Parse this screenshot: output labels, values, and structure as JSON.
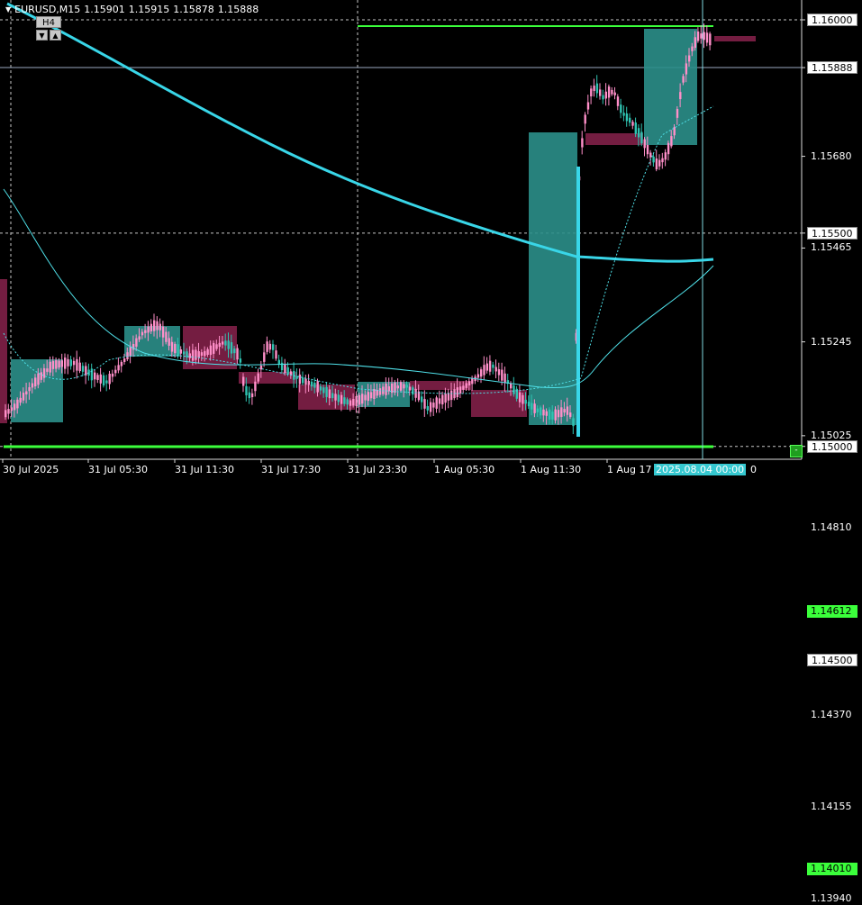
{
  "header": {
    "symbol": "EURUSD,M15",
    "open": "1.15901",
    "high": "1.15915",
    "low": "1.15878",
    "close": "1.15888",
    "timeframe_button": "H4",
    "collapse_button": "▼",
    "expand_button": "▲"
  },
  "price_axis": {
    "levels": [
      {
        "value": 1.16,
        "label": "1.16000",
        "style": "box"
      },
      {
        "value": 1.15888,
        "label": "1.15888",
        "style": "box"
      },
      {
        "value": 1.1568,
        "label": "1.15680",
        "style": "plain"
      },
      {
        "value": 1.155,
        "label": "1.15500",
        "style": "box"
      },
      {
        "value": 1.15465,
        "label": "1.15465",
        "style": "plain"
      },
      {
        "value": 1.15245,
        "label": "1.15245",
        "style": "plain"
      },
      {
        "value": 1.15025,
        "label": "1.15025",
        "style": "plain"
      },
      {
        "value": 1.15,
        "label": "1.15000",
        "style": "box"
      },
      {
        "value": 1.1481,
        "label": "1.14810",
        "style": "plain"
      },
      {
        "value": 1.14612,
        "label": "1.14612",
        "style": "green"
      },
      {
        "value": 1.145,
        "label": "1.14500",
        "style": "box"
      },
      {
        "value": 1.1437,
        "label": "1.14370",
        "style": "plain"
      },
      {
        "value": 1.14155,
        "label": "1.14155",
        "style": "plain"
      },
      {
        "value": 1.1401,
        "label": "1.14010",
        "style": "green"
      },
      {
        "value": 1.1394,
        "label": "1.13940",
        "style": "plain"
      }
    ]
  },
  "time_axis": {
    "labels": [
      "30 Jul 2025",
      "31 Jul 05:30",
      "31 Jul 11:30",
      "31 Jul 17:30",
      "31 Jul 23:30",
      "1 Aug 05:30",
      "1 Aug 11:30",
      "1 Aug 17"
    ],
    "crosshair_label": "2025.08.04 00:00",
    "crosshair_suffix": "0"
  },
  "corner_button": "-",
  "colors": {
    "background": "#000000",
    "bull_candle": "#ff8fc9",
    "bear_candle": "#2fc4b2",
    "bull_zone": "#2b8f8a",
    "bear_zone": "#7a1f45",
    "ma_thick": "#39d6e8",
    "ma_thin": "#4fe0e8",
    "level_green": "#3bff3b",
    "grid_dash": "#c8c8c8"
  }
}
